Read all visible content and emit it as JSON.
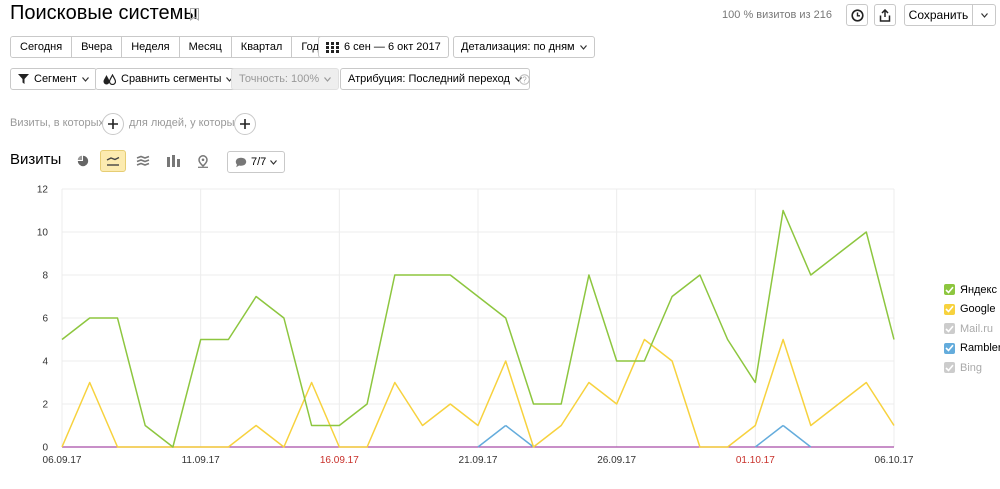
{
  "header": {
    "title": "Поисковые системы",
    "visits_info": "100 % визитов из 216",
    "save_label": "Сохранить"
  },
  "period": {
    "buttons": [
      "Сегодня",
      "Вчера",
      "Неделя",
      "Месяц",
      "Квартал",
      "Год"
    ],
    "date_range": "6 сен — 6 окт 2017",
    "detail_label": "Детализация: по дням"
  },
  "filters": {
    "segment_label": "Сегмент",
    "compare_label": "Сравнить сегменты",
    "accuracy_label": "Точность: 100%",
    "attribution_label": "Атрибуция: Последний переход"
  },
  "conditions": {
    "visits_label": "Визиты, в которых",
    "people_label": "для людей, у которых"
  },
  "chart_header": {
    "title": "Визиты",
    "series_counter": "7/7"
  },
  "colors": {
    "yandex": "#8dc63f",
    "google": "#f7d23e",
    "rambler": "#64acdc",
    "disabled": "#cccccc",
    "purple_line": "#a64ca6",
    "weekend": "#c8312b"
  },
  "chart_data": {
    "type": "line",
    "ylim": [
      0,
      12
    ],
    "yticks": [
      0,
      2,
      4,
      6,
      8,
      10,
      12
    ],
    "x": [
      "06.09.17",
      "07.09.17",
      "08.09.17",
      "09.09.17",
      "10.09.17",
      "11.09.17",
      "12.09.17",
      "13.09.17",
      "14.09.17",
      "15.09.17",
      "16.09.17",
      "17.09.17",
      "18.09.17",
      "19.09.17",
      "20.09.17",
      "21.09.17",
      "22.09.17",
      "23.09.17",
      "24.09.17",
      "25.09.17",
      "26.09.17",
      "27.09.17",
      "28.09.17",
      "29.09.17",
      "30.09.17",
      "01.10.17",
      "02.10.17",
      "03.10.17",
      "04.10.17",
      "05.10.17",
      "06.10.17"
    ],
    "xtick_labels": [
      {
        "index": 0,
        "label": "06.09.17",
        "weekend": false
      },
      {
        "index": 5,
        "label": "11.09.17",
        "weekend": false
      },
      {
        "index": 10,
        "label": "16.09.17",
        "weekend": true
      },
      {
        "index": 15,
        "label": "21.09.17",
        "weekend": false
      },
      {
        "index": 20,
        "label": "26.09.17",
        "weekend": false
      },
      {
        "index": 25,
        "label": "01.10.17",
        "weekend": true
      },
      {
        "index": 30,
        "label": "06.10.17",
        "weekend": false
      }
    ],
    "series": [
      {
        "name": "Яндекс",
        "color": "#8dc63f",
        "enabled": true,
        "values": [
          5,
          6,
          6,
          1,
          0,
          5,
          5,
          7,
          6,
          1,
          1,
          2,
          8,
          8,
          8,
          7,
          6,
          2,
          2,
          8,
          4,
          4,
          7,
          8,
          5,
          3,
          11,
          8,
          9,
          10,
          5
        ]
      },
      {
        "name": "Google",
        "color": "#f7d23e",
        "enabled": true,
        "values": [
          0,
          3,
          0,
          0,
          0,
          0,
          0,
          1,
          0,
          3,
          0,
          0,
          3,
          1,
          2,
          1,
          4,
          0,
          1,
          3,
          2,
          5,
          4,
          0,
          0,
          1,
          5,
          1,
          2,
          3,
          1
        ]
      },
      {
        "name": "Mail.ru",
        "color": "#cccccc",
        "enabled": false,
        "values": [
          0,
          0,
          0,
          0,
          0,
          0,
          0,
          0,
          0,
          0,
          0,
          0,
          0,
          0,
          0,
          0,
          0,
          0,
          0,
          0,
          0,
          0,
          0,
          0,
          0,
          0,
          0,
          0,
          0,
          0,
          0
        ]
      },
      {
        "name": "Rambler",
        "color": "#64acdc",
        "enabled": true,
        "values": [
          0,
          0,
          0,
          0,
          0,
          0,
          0,
          0,
          0,
          0,
          0,
          0,
          0,
          0,
          0,
          0,
          1,
          0,
          0,
          0,
          0,
          0,
          0,
          0,
          0,
          0,
          1,
          0,
          0,
          0,
          0
        ]
      },
      {
        "name": "Bing",
        "color": "#cccccc",
        "enabled": false,
        "values": [
          0,
          0,
          0,
          0,
          0,
          0,
          0,
          0,
          0,
          0,
          0,
          0,
          0,
          0,
          0,
          0,
          0,
          0,
          0,
          0,
          0,
          0,
          0,
          0,
          0,
          0,
          0,
          0,
          0,
          0,
          0
        ]
      }
    ]
  }
}
